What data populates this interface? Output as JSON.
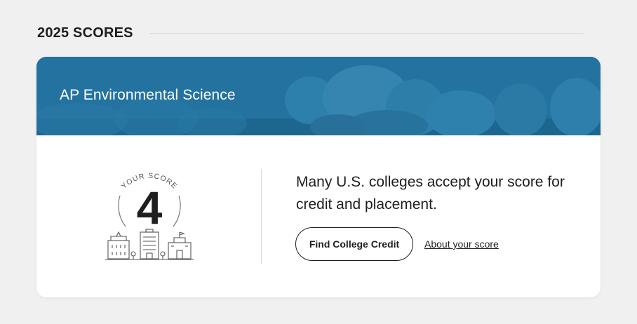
{
  "section": {
    "title": "2025 SCORES"
  },
  "card": {
    "subject": "AP Environmental Science",
    "banner_color": "#1f6f9c",
    "score_label": "YOUR SCORE",
    "score": "4",
    "message": "Many U.S. colleges accept your score for credit and placement.",
    "cta_label": "Find College Credit",
    "about_link": "About your score"
  }
}
